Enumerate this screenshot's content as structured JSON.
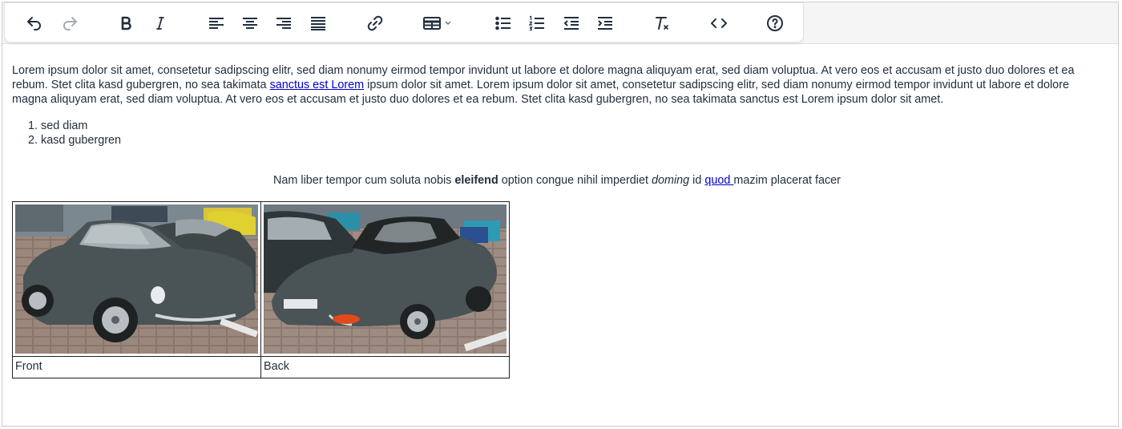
{
  "toolbar": {
    "buttons": [
      {
        "name": "undo",
        "icon": "undo-icon"
      },
      {
        "name": "redo",
        "icon": "redo-icon"
      },
      {
        "name": "bold",
        "icon": "bold-icon"
      },
      {
        "name": "italic",
        "icon": "italic-icon"
      },
      {
        "name": "align-left",
        "icon": "align-left-icon"
      },
      {
        "name": "align-center",
        "icon": "align-center-icon"
      },
      {
        "name": "align-right",
        "icon": "align-right-icon"
      },
      {
        "name": "align-justify",
        "icon": "align-justify-icon"
      },
      {
        "name": "link",
        "icon": "link-icon"
      },
      {
        "name": "table",
        "icon": "table-icon"
      },
      {
        "name": "bullet-list",
        "icon": "bullet-list-icon"
      },
      {
        "name": "numbered-list",
        "icon": "numbered-list-icon"
      },
      {
        "name": "outdent",
        "icon": "outdent-icon"
      },
      {
        "name": "indent",
        "icon": "indent-icon"
      },
      {
        "name": "clear-formatting",
        "icon": "remove-format-icon"
      },
      {
        "name": "source-code",
        "icon": "code-icon"
      },
      {
        "name": "help",
        "icon": "help-icon"
      }
    ]
  },
  "content": {
    "paragraph1_part1": "Lorem ipsum dolor sit amet, consetetur sadipscing elitr, sed diam nonumy eirmod tempor invidunt ut labore et dolore magna aliquyam erat, sed diam voluptua. At vero eos et accusam et justo duo dolores et ea rebum. Stet clita kasd gubergren, no sea takimata ",
    "paragraph1_link": "sanctus est Lorem",
    "paragraph1_part2": " ipsum dolor sit amet. Lorem ipsum dolor sit amet, consetetur sadipscing elitr, sed diam nonumy eirmod tempor invidunt ut labore et dolore magna aliquyam erat, sed diam voluptua. At vero eos et accusam et justo duo dolores et ea rebum. Stet clita kasd gubergren, no sea takimata sanctus est Lorem ipsum dolor sit amet.",
    "list_items": [
      "sed diam",
      "kasd gubergren"
    ],
    "center_text_1": "Nam liber tempor cum soluta nobis ",
    "center_bold": "eleifend",
    "center_text_2": " option congue nihil imperdiet ",
    "center_italic": "doming",
    "center_text_3": " id ",
    "center_link": "quod ",
    "center_text_4": "mazim placerat facer"
  },
  "table": {
    "captions": [
      "Front",
      "Back"
    ]
  },
  "colors": {
    "text": "#222f3e",
    "link": "#0000cc",
    "toolbar_bg": "#f5f5f5",
    "icon": "#222f3e",
    "icon_disabled": "#a6abb0",
    "car_body": "#4a5356"
  }
}
